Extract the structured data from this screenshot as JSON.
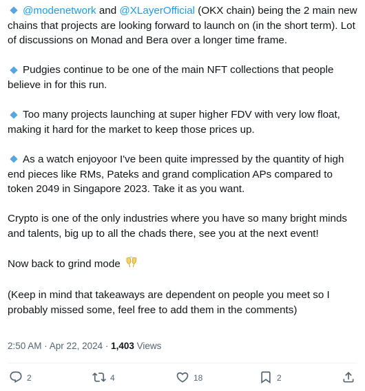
{
  "tweet": {
    "p1": {
      "mention1": "@modenetwork",
      "and": " and ",
      "mention2": "@XLayerOfficial",
      "rest": " (OKX chain) being the 2 main new chains that projects are looking forward to launch on (in the short term). Lot of discussions on Monad and Bera over a longer time frame."
    },
    "p2": "Pudgies continue to be one of the main NFT collections that people believe in for this run.",
    "p3": "Too many projects launching at super higher FDV with very low float, making it hard for the market to keep those prices up.",
    "p4": "As a watch enjoyoor I've been quite impressed by the quantity of high end pieces like RMs, Pateks and grand complication APs compared to token 2049 in Singapore 2023. Take it as you want.",
    "p5": "Crypto is one of the only industries where you have so many bright minds and talents, big up to all the chads there, see you at the next event!",
    "p6": "Now back to grind mode",
    "p7": "(Keep in mind that takeaways are dependent on people you meet so I probably missed some, feel free to add them in the comments)"
  },
  "meta": {
    "time": "2:50 AM",
    "separator": " · ",
    "date": "Apr 22, 2024",
    "views_count": "1,403",
    "views_label": " Views"
  },
  "actions": {
    "reply_count": "2",
    "retweet_count": "4",
    "like_count": "18",
    "bookmark_count": "2"
  },
  "icons": {
    "bullet": "blue-diamond-icon",
    "emoji": "clinking-glasses-icon",
    "reply": "reply-icon",
    "retweet": "retweet-icon",
    "like": "heart-icon",
    "bookmark": "bookmark-icon",
    "share": "share-icon"
  },
  "colors": {
    "text": "#0f1419",
    "muted": "#536471",
    "link": "#1d9bf0",
    "bullet": "#5aa4e0",
    "divider": "#eff3f4"
  }
}
